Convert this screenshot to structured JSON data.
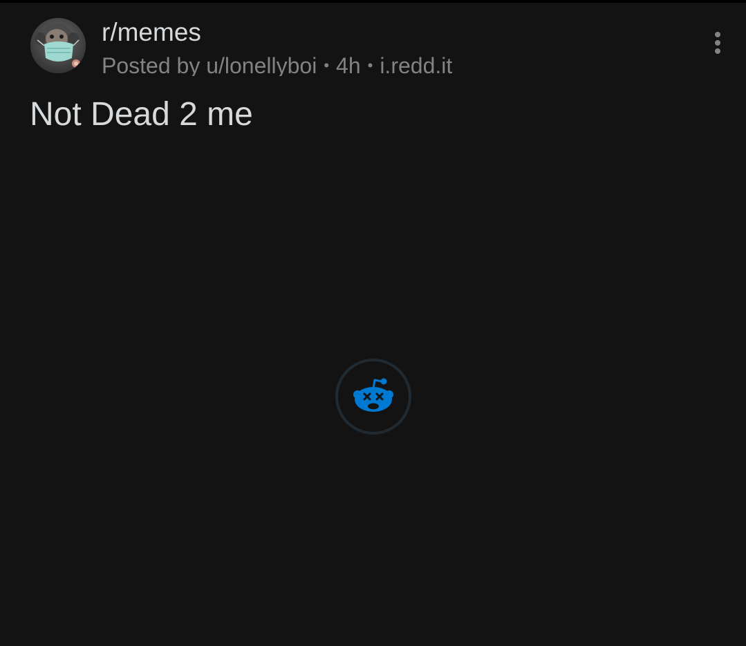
{
  "post": {
    "subreddit": "r/memes",
    "posted_by": "Posted by u/lonellyboi",
    "separator": "•",
    "age": "4h",
    "domain": "i.redd.it",
    "title": "Not Dead 2 me"
  },
  "icons": {
    "avatar": "monkey-avatar-icon",
    "overflow": "more-vertical-icon",
    "loader": "reddit-snoo-loading-icon"
  },
  "colors": {
    "background": "#131313",
    "primary_text": "#d7dadc",
    "secondary_text": "#818384",
    "accent": "#0079d3"
  }
}
